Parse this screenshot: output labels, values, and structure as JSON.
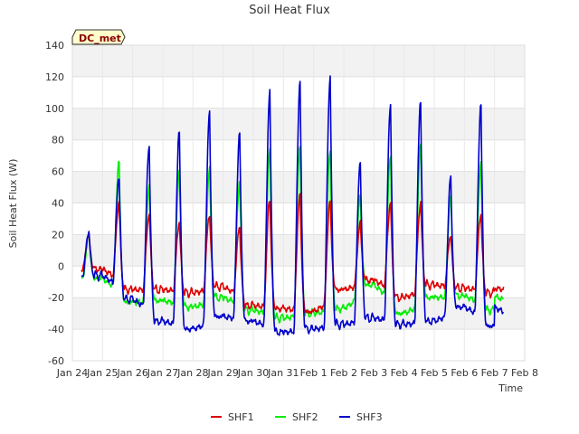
{
  "chart_data": {
    "type": "line",
    "title": "Soil Heat Flux",
    "xlabel": "Time",
    "ylabel": "Soil Heat Flux (W)",
    "site_label": "DC_met",
    "ylim": [
      -60,
      140
    ],
    "yticks": [
      -60,
      -40,
      -20,
      0,
      20,
      40,
      60,
      80,
      100,
      120,
      140
    ],
    "xlim": [
      0,
      15
    ],
    "xticks": [
      0,
      1,
      2,
      3,
      4,
      5,
      6,
      7,
      8,
      9,
      10,
      11,
      12,
      13,
      14,
      15
    ],
    "xtick_labels": [
      "Jan 24",
      "Jan 25",
      "Jan 26",
      "Jan 27",
      "Jan 28",
      "Jan 29",
      "Jan 30",
      "Jan 31",
      "Feb 1",
      "Feb 2",
      "Feb 3",
      "Feb 4",
      "Feb 5",
      "Feb 6",
      "Feb 7",
      "Feb 8"
    ],
    "grid": true,
    "legend_position": "bottom",
    "series": [
      {
        "name": "SHF1",
        "color": "#dd0000",
        "peaks": [
          20,
          40,
          33,
          28,
          33,
          25,
          42,
          45,
          41,
          27,
          40,
          40,
          20,
          33
        ],
        "troughs": [
          -2,
          -15,
          -15,
          -17,
          -13,
          -25,
          -27,
          -29,
          -15,
          -9,
          -20,
          -12,
          -14,
          -17
        ]
      },
      {
        "name": "SHF2",
        "color": "#00ee00",
        "peaks": [
          20,
          66,
          50,
          60,
          62,
          54,
          75,
          77,
          74,
          45,
          69,
          76,
          44,
          65
        ],
        "troughs": [
          -8,
          -23,
          -22,
          -26,
          -20,
          -28,
          -33,
          -30,
          -27,
          -12,
          -30,
          -20,
          -19,
          -28
        ]
      },
      {
        "name": "SHF3",
        "color": "#0000cc",
        "peaks": [
          22,
          57,
          76,
          86,
          97,
          84,
          110,
          117,
          120,
          67,
          103,
          105,
          57,
          102
        ],
        "troughs": [
          -6,
          -21,
          -35,
          -40,
          -32,
          -35,
          -42,
          -40,
          -37,
          -33,
          -37,
          -35,
          -26,
          -38
        ]
      }
    ]
  }
}
